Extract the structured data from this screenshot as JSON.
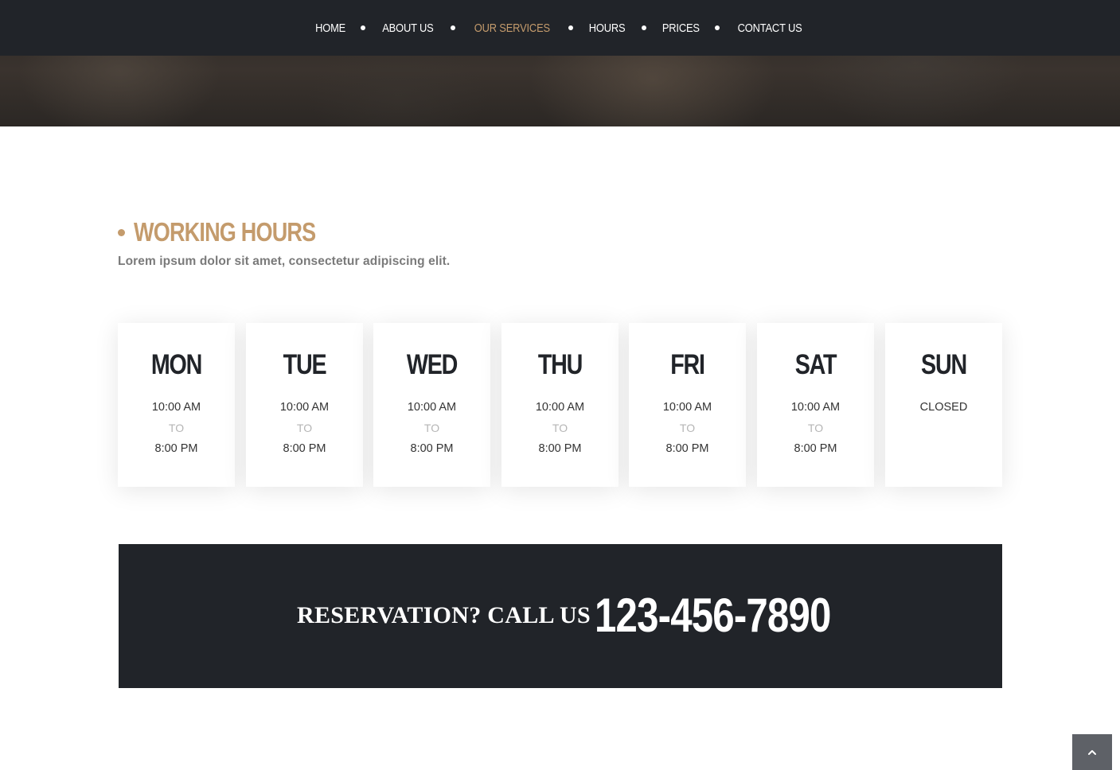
{
  "nav": {
    "items": [
      {
        "label": "HOME",
        "active": false
      },
      {
        "label": "ABOUT US",
        "active": false
      },
      {
        "label": "OUR SERVICES",
        "active": true
      },
      {
        "label": "HOURS",
        "active": false
      },
      {
        "label": "PRICES",
        "active": false
      },
      {
        "label": "CONTACT US",
        "active": false
      }
    ]
  },
  "section": {
    "title": "WORKING HOURS",
    "subtitle": "Lorem ipsum dolor sit amet, consectetur adipiscing elit."
  },
  "hours": {
    "days": [
      {
        "day": "MON",
        "open": "10:00 AM",
        "sep": "TO",
        "close": "8:00 PM"
      },
      {
        "day": "TUE",
        "open": "10:00 AM",
        "sep": "TO",
        "close": "8:00 PM"
      },
      {
        "day": "WED",
        "open": "10:00 AM",
        "sep": "TO",
        "close": "8:00 PM"
      },
      {
        "day": "THU",
        "open": "10:00 AM",
        "sep": "TO",
        "close": "8:00 PM"
      },
      {
        "day": "FRI",
        "open": "10:00 AM",
        "sep": "TO",
        "close": "8:00 PM"
      },
      {
        "day": "SAT",
        "open": "10:00 AM",
        "sep": "TO",
        "close": "8:00 PM"
      },
      {
        "day": "SUN",
        "open": "CLOSED",
        "sep": "",
        "close": ""
      }
    ]
  },
  "reservation": {
    "label": "RESERVATION? CALL US",
    "phone": "123-456-7890"
  },
  "icons": {
    "back_to_top": "chevron-up-icon"
  },
  "colors": {
    "accent": "#c49b6c",
    "dark": "#212429"
  }
}
